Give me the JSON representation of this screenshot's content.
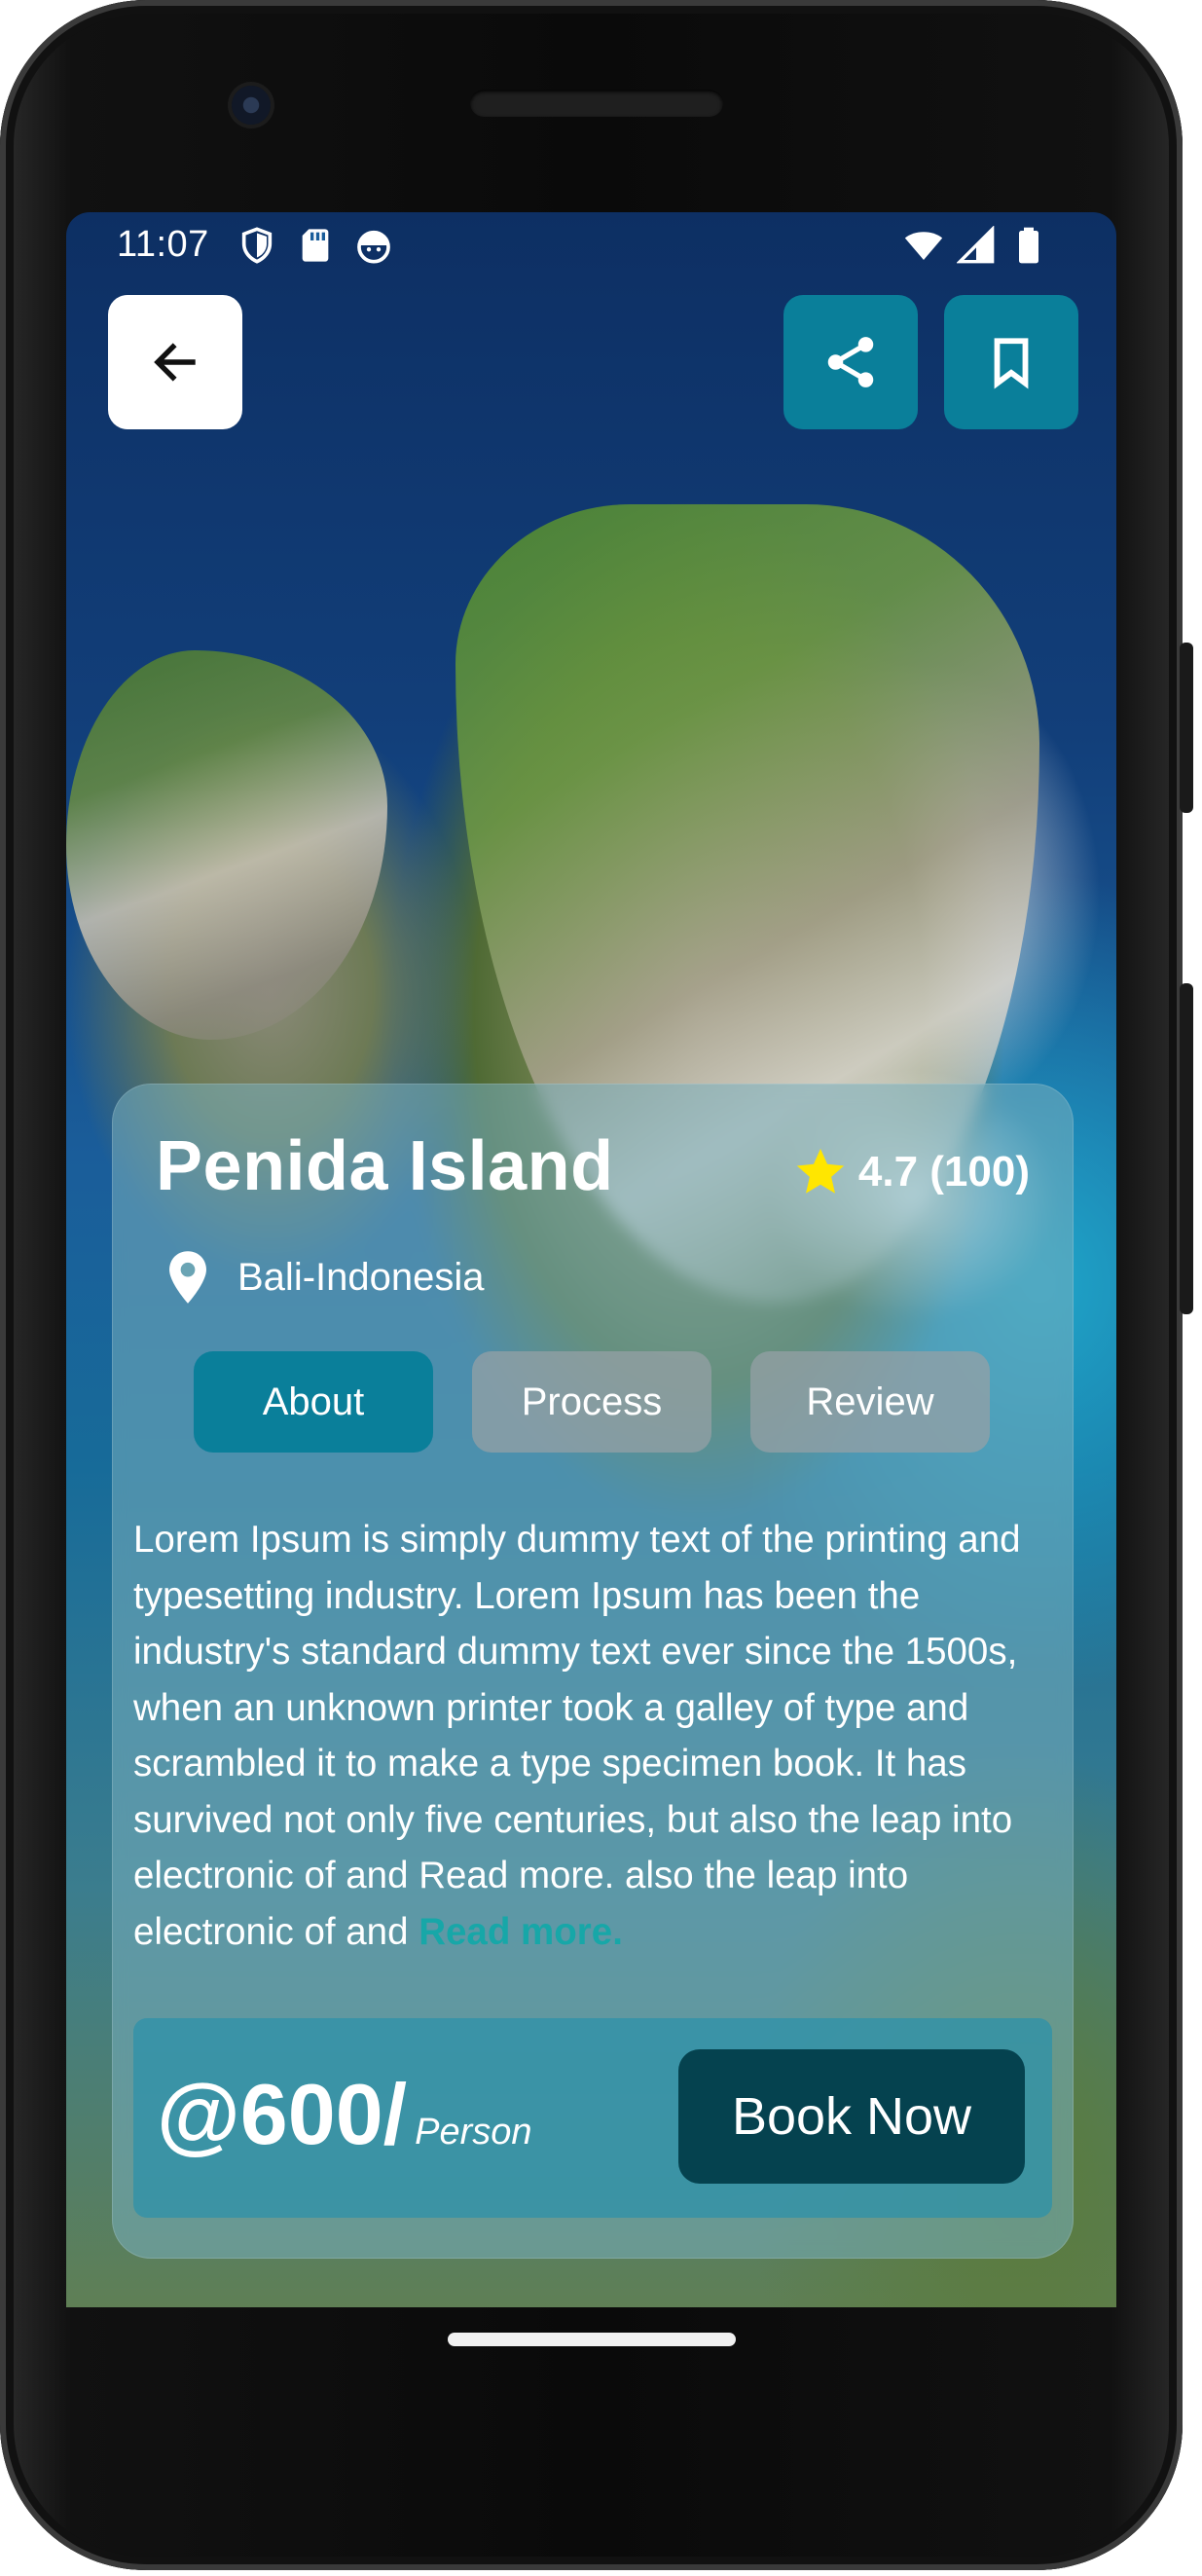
{
  "status_bar": {
    "time": "11:07",
    "left_icons": [
      "shield-icon",
      "sd-card-icon",
      "android-face-icon"
    ],
    "right_icons": [
      "wifi-icon",
      "cell-signal-icon",
      "battery-icon"
    ]
  },
  "header": {
    "back_icon": "arrow-left-icon",
    "share_icon": "share-icon",
    "bookmark_icon": "bookmark-icon"
  },
  "place": {
    "name": "Penida Island",
    "rating": "4.7 (100)",
    "location": "Bali-Indonesia"
  },
  "tabs": [
    {
      "label": "About",
      "active": true
    },
    {
      "label": "Process",
      "active": false
    },
    {
      "label": "Review",
      "active": false
    }
  ],
  "about": {
    "text": "Lorem Ipsum is simply dummy text of the printing and typesetting industry. Lorem Ipsum has been the industry's standard dummy text ever since the 1500s, when an unknown printer took a galley of type and scrambled it to make a type specimen book. It has survived not only five centuries, but also the leap into electronic of and Read more. also the leap into electronic of and ",
    "read_more": "Read more."
  },
  "booking": {
    "price": "@600/",
    "unit": "Person",
    "button_label": "Book Now"
  },
  "colors": {
    "accent": "#0a7f9a",
    "button_dark": "#05424f",
    "read_more": "#17a7a8",
    "star": "#ffe600"
  }
}
